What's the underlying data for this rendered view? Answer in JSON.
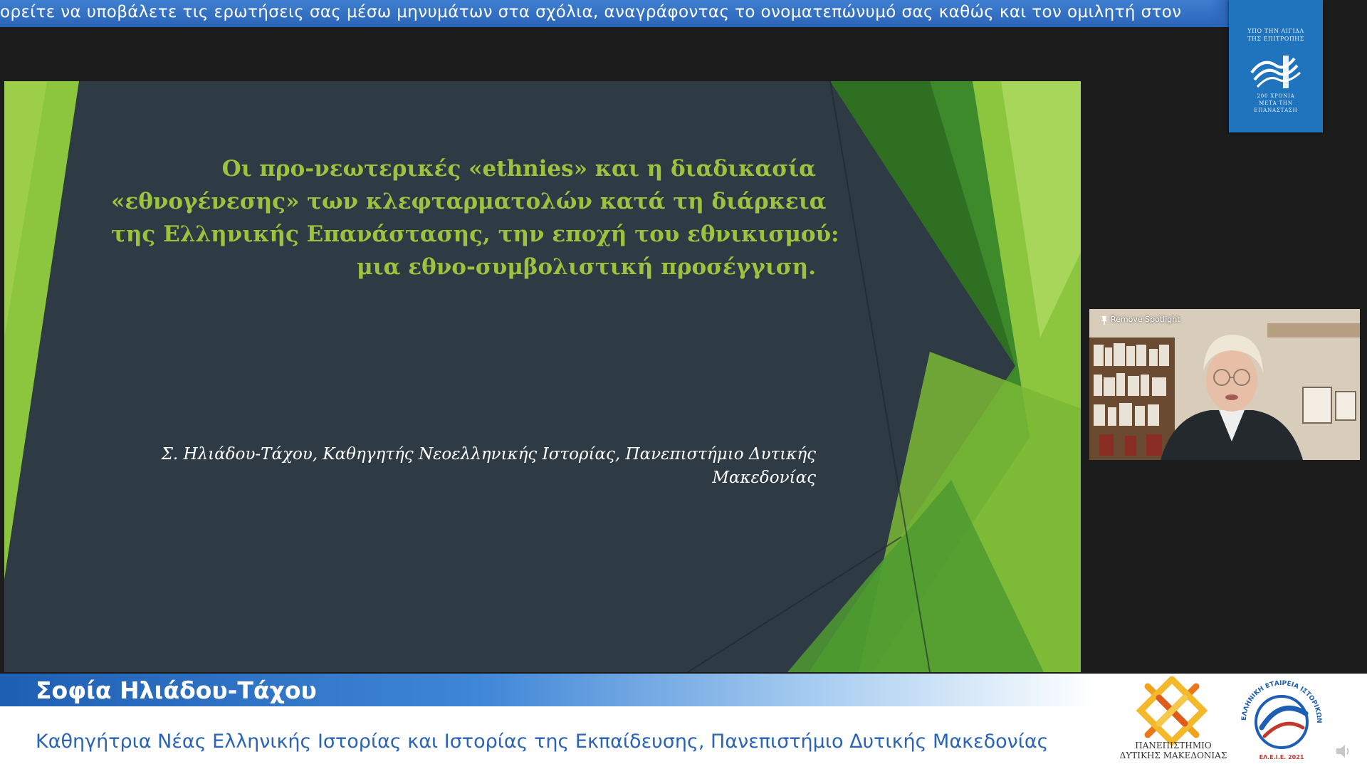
{
  "ticker": {
    "text": "ορείτε να υποβάλετε τις ερωτήσεις σας μέσω μηνυμάτων στα σχόλια, αναγράφοντας το ονοματεπώνυμό σας καθώς και τον ομιλητή στον"
  },
  "badge": {
    "top_line1": "ΥΠΟ ΤΗΝ ΑΙΓΙΔΑ",
    "top_line2": "ΤΗΣ ΕΠΙΤΡΟΠΗΣ",
    "bottom_line1": "200 ΧΡΟΝΙΑ",
    "bottom_line2": "ΜΕΤΑ ΤΗΝ",
    "bottom_line3": "ΕΠΑΝΑΣΤΑΣΗ"
  },
  "slide": {
    "title_lines": [
      "Οι προ-νεωτερικές «ethnies» και η διαδικασία",
      "«εθνογένεσης» των κλεφταρματολών κατά τη διάρκεια",
      "της Ελληνικής Επανάστασης, την εποχή του εθνικισμού:",
      "μια εθνο-συμβολιστική προσέγγιση."
    ],
    "author_lines": [
      "Σ. Ηλιάδου-Τάχου, Καθηγητής Νεοελληνικής Ιστορίας, Πανεπιστήμιο Δυτικής",
      "Μακεδονίας"
    ],
    "colors": {
      "background": "#2e3b45",
      "title": "#9cc33d",
      "green_dark": "#3d8a2a",
      "green_light": "#8cc63f"
    }
  },
  "cam": {
    "spotlight_label": "Remove Spotlight"
  },
  "lower_third": {
    "name": "Σοφία Ηλιάδου-Τάχου",
    "subtitle": "Καθηγήτρια Νέας Ελληνικής Ιστορίας και Ιστορίας της Εκπαίδευσης, Πανεπιστήμιο Δυτικής Μακεδονίας",
    "university_logo_line1": "ΠΑΝΕΠΙΣΤΗΜΙΟ",
    "university_logo_line2": "ΔΥΤΙΚΗΣ ΜΑΚΕΔΟΝΙΑΣ",
    "society_logo_ring": "ΕΛΛΗΝΙΚΗ ΕΤΑΙΡΕΙΑ ΙΣΤΟΡΙΚΩΝ ΤΗΣ ΕΚΠΑΙΔΕΥΣΗΣ",
    "society_logo_year": "ΕΛ.Ε.Ι.Ε. 2021",
    "accent": "#2a64b8"
  },
  "icons": {
    "pin": "pin-icon",
    "speaker": "speaker-icon"
  }
}
